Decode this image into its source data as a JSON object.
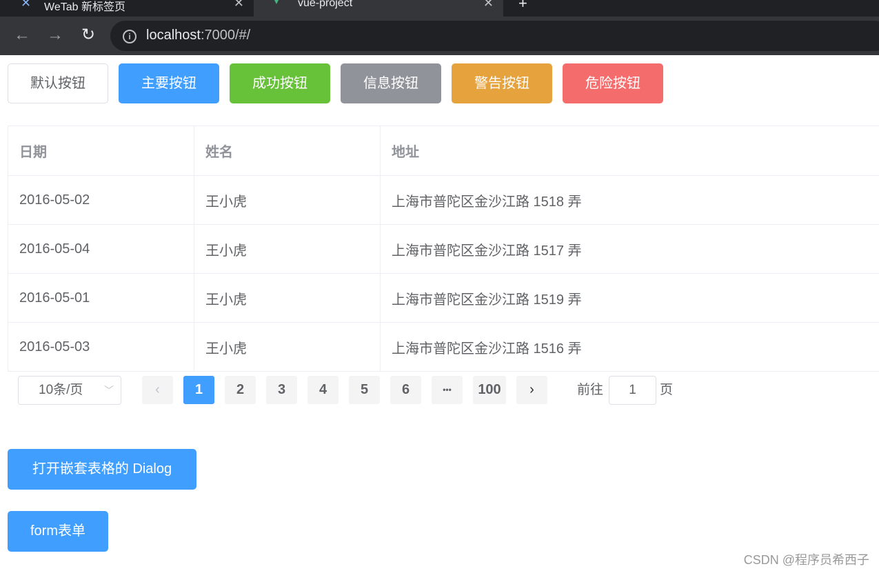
{
  "browser": {
    "tabs": [
      {
        "title": "WeTab 新标签页",
        "close": "✕"
      },
      {
        "title": "vue-project",
        "close": "✕"
      }
    ],
    "new_tab": "+",
    "url_host": "localhost",
    "url_rest": ":7000/#/"
  },
  "buttons": {
    "default": "默认按钮",
    "primary": "主要按钮",
    "success": "成功按钮",
    "info": "信息按钮",
    "warning": "警告按钮",
    "danger": "危险按钮"
  },
  "colors": {
    "primary": "#409eff",
    "success": "#67c23a",
    "info": "#909399",
    "warning": "#e6a23c",
    "danger": "#f56c6c"
  },
  "table": {
    "headers": [
      "日期",
      "姓名",
      "地址"
    ],
    "rows": [
      [
        "2016-05-02",
        "王小虎",
        "上海市普陀区金沙江路 1518 弄"
      ],
      [
        "2016-05-04",
        "王小虎",
        "上海市普陀区金沙江路 1517 弄"
      ],
      [
        "2016-05-01",
        "王小虎",
        "上海市普陀区金沙江路 1519 弄"
      ],
      [
        "2016-05-03",
        "王小虎",
        "上海市普陀区金沙江路 1516 弄"
      ]
    ]
  },
  "pagination": {
    "page_size": "10条/页",
    "prev": "‹",
    "pages": [
      "1",
      "2",
      "3",
      "4",
      "5",
      "6",
      "•••",
      "100"
    ],
    "current": "1",
    "next": "›",
    "goto_label": "前往",
    "goto_value": "1",
    "goto_suffix": "页"
  },
  "actions": {
    "dialog_button": "打开嵌套表格的 Dialog",
    "form_button": "form表单"
  },
  "watermark": "CSDN @程序员希西子"
}
